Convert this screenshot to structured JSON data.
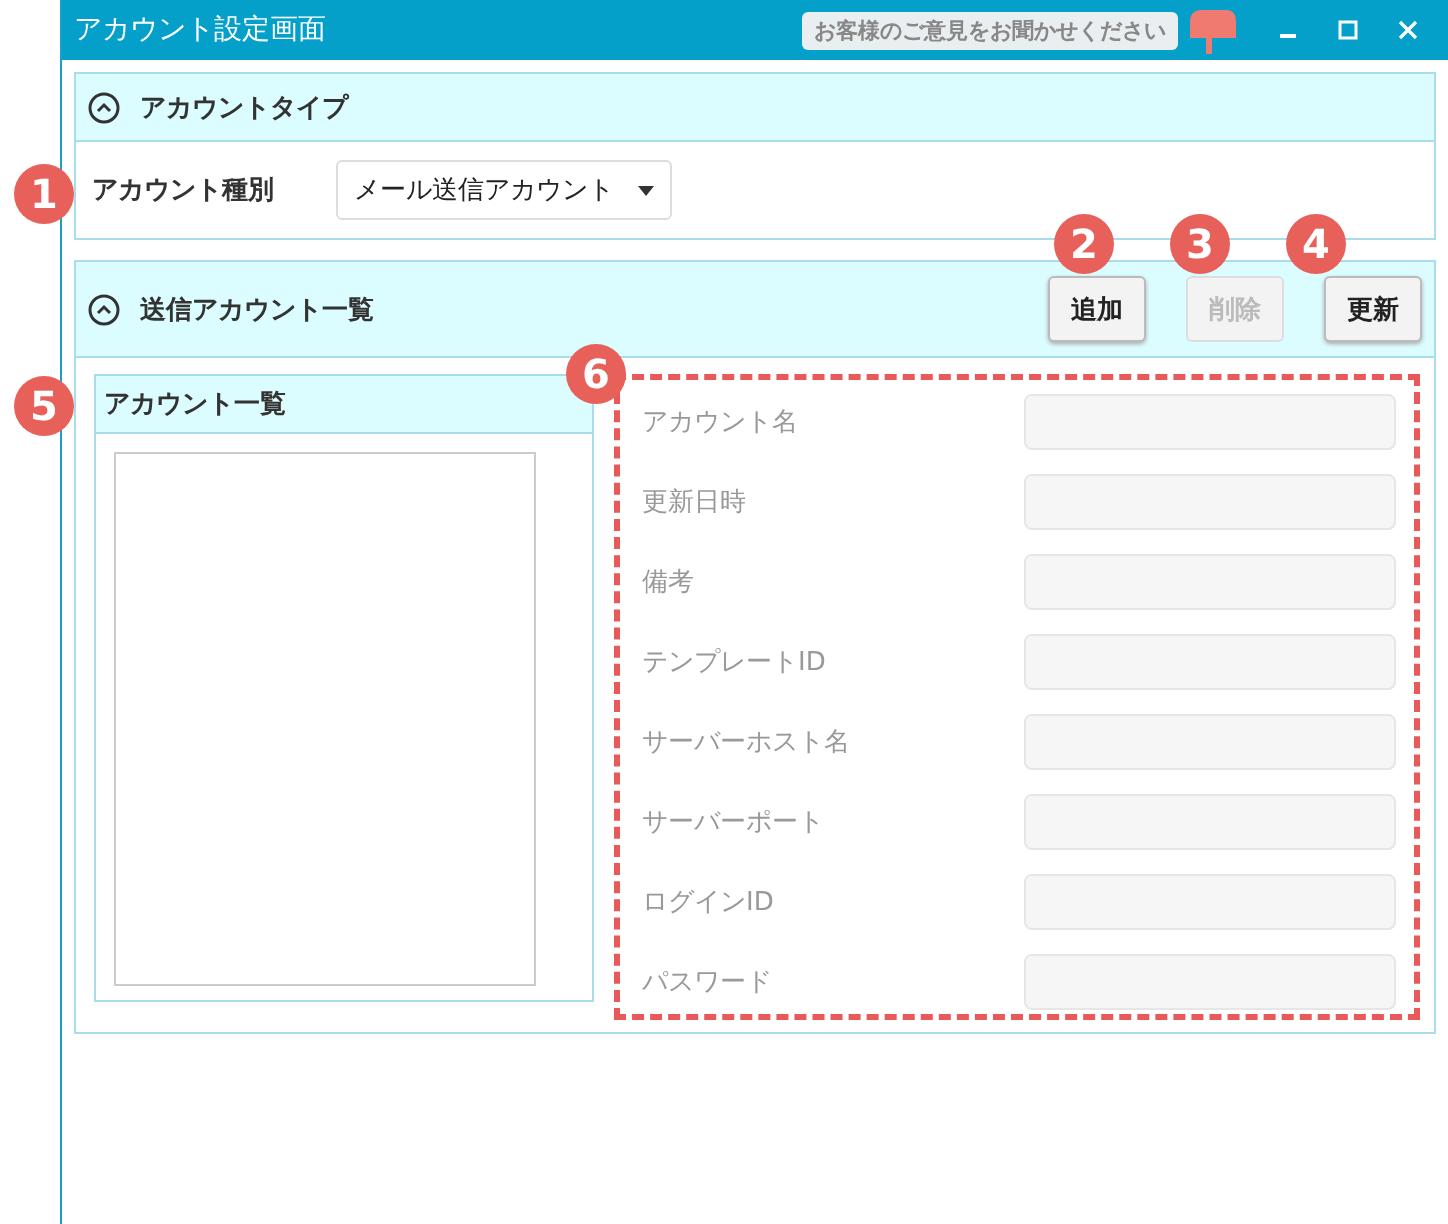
{
  "window": {
    "title": "アカウント設定画面",
    "feedback": "お客様のご意見をお聞かせください"
  },
  "account_type": {
    "title": "アカウントタイプ",
    "expanded": true,
    "label": "アカウント種別",
    "select_value": "メール送信アカウント"
  },
  "send_accounts": {
    "title": "送信アカウント一覧",
    "expanded": true,
    "buttons": [
      {
        "label": "追加",
        "disabled": false
      },
      {
        "label": "削除",
        "disabled": true
      },
      {
        "label": "更新",
        "disabled": false
      }
    ],
    "list": {
      "title": "アカウント一覧"
    },
    "fields": [
      {
        "label": "アカウント名",
        "disabled": true
      },
      {
        "label": "更新日時",
        "disabled": true
      },
      {
        "label": "備考",
        "disabled": true
      },
      {
        "label": "テンプレートID",
        "disabled": true
      },
      {
        "label": "サーバーホスト名",
        "disabled": true
      },
      {
        "label": "サーバーポート",
        "disabled": true
      },
      {
        "label": "ログインID",
        "disabled": true
      },
      {
        "label": "パスワード",
        "disabled": true
      }
    ]
  },
  "callouts": [
    {
      "label": "1"
    },
    {
      "label": "2"
    },
    {
      "label": "3"
    },
    {
      "label": "4"
    },
    {
      "label": "5"
    },
    {
      "label": "6"
    }
  ]
}
